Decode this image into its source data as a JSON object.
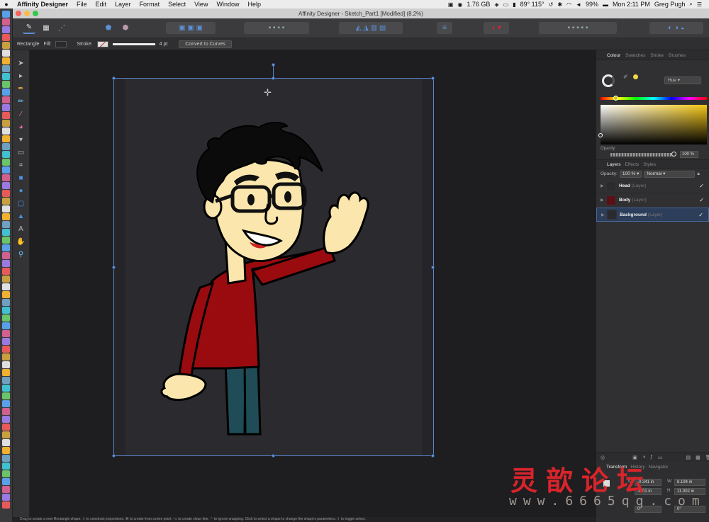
{
  "menubar": {
    "apple": "",
    "app_name": "Affinity Designer",
    "menus": [
      "File",
      "Edit",
      "Layer",
      "Format",
      "Select",
      "View",
      "Window",
      "Help"
    ],
    "memory": "1.76 GB",
    "temp": "89° 115°",
    "battery": "99%",
    "clock": "Mon 2:11 PM",
    "user": "Greg Pugh"
  },
  "window": {
    "title": "Affinity Designer - Sketch_Part1 [Modified] (8.2%)"
  },
  "context_bar": {
    "tool_name": "Rectangle",
    "fill_label": "Fill:",
    "stroke_label": "Stroke:",
    "stroke_width": "4 pt",
    "convert_button": "Convert to Curves"
  },
  "panels": {
    "colour_tabs": [
      "Colour",
      "Swatches",
      "Stroke",
      "Brushes"
    ],
    "colour_mode": "Hue",
    "opacity_label": "Opacity",
    "opacity_value": "100 %",
    "colors": {
      "accent": "#f4c613",
      "selection": "#5a85c8"
    }
  },
  "layers": {
    "tabs": [
      "Layers",
      "Effects",
      "Styles"
    ],
    "opacity_label": "Opacity:",
    "opacity_value": "100 %",
    "blend_mode": "Normal",
    "items": [
      {
        "name": "Head",
        "kind": "(Layer)",
        "visible": "✓"
      },
      {
        "name": "Body",
        "kind": "(Layer)",
        "visible": "✓"
      },
      {
        "name": "Background",
        "kind": "(Layer)",
        "visible": "✓"
      }
    ]
  },
  "transform": {
    "tabs": [
      "Transform",
      "History",
      "Navigator"
    ],
    "x_label": "X:",
    "x_value": "-0.341 in",
    "y_label": "Y:",
    "y_value": "-0.01 in",
    "w_label": "W:",
    "w_value": "8.194 in",
    "h_label": "H:",
    "h_value": "11.002 in",
    "rotation": "0°",
    "shear": "0°"
  },
  "statusbar": {
    "text": "Drag to create a new Rectangle shape. ⇧ to constrain proportions. ⌘ to create from centre point. ⌥ to create clean line. ⌃ to ignore snapping. Click to select a shape to change the shape's parameters. ⇧ to toggle select."
  },
  "watermark": {
    "chars": "灵歆论坛",
    "url": "www.6665qq.com"
  }
}
